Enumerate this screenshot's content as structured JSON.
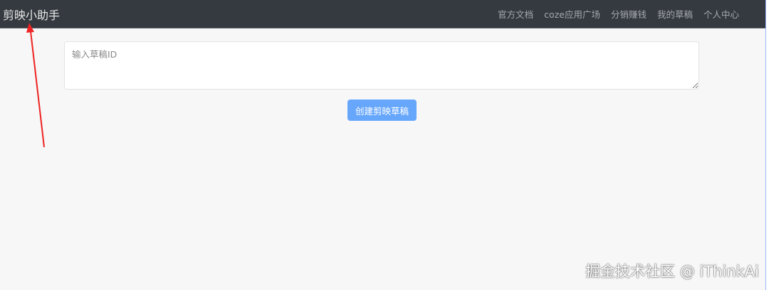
{
  "navbar": {
    "brand": "剪映小助手",
    "links": [
      "官方文档",
      "coze应用广场",
      "分销赚钱",
      "我的草稿",
      "个人中心"
    ]
  },
  "form": {
    "draft_id_placeholder": "输入草稿ID",
    "draft_id_value": "",
    "create_button": "创建剪映草稿"
  },
  "watermark": "掘金技术社区 @ iThinkAi",
  "colors": {
    "navbar": "#343a40",
    "button": "#66a6fb",
    "arrow": "#ee2222"
  }
}
